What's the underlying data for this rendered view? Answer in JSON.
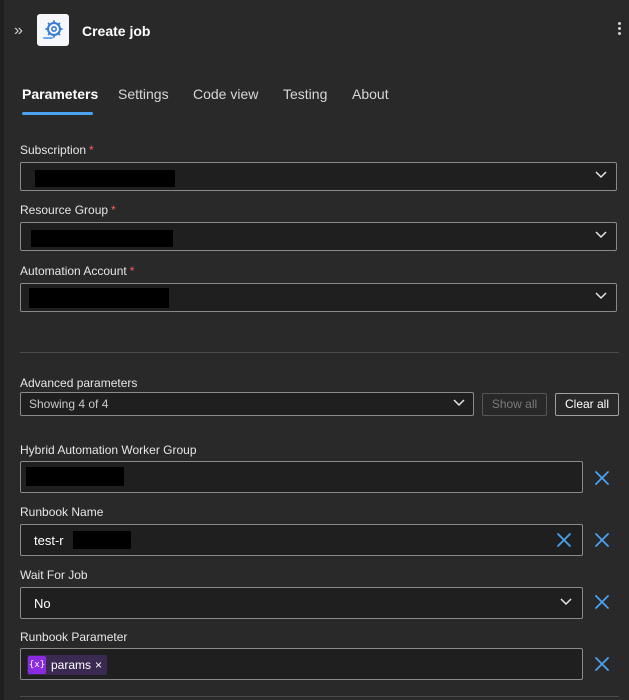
{
  "header": {
    "title": "Create job",
    "collapse_glyph": "»",
    "app_icon": "gear-cloud-icon",
    "more_icon": "more-vertical-icon"
  },
  "tabs": [
    {
      "label": "Parameters",
      "active": true
    },
    {
      "label": "Settings",
      "active": false
    },
    {
      "label": "Code view",
      "active": false
    },
    {
      "label": "Testing",
      "active": false
    },
    {
      "label": "About",
      "active": false
    }
  ],
  "required_fields": {
    "subscription_label": "Subscription",
    "resource_group_label": "Resource Group",
    "automation_account_label": "Automation Account",
    "required_mark": "*"
  },
  "advanced": {
    "label": "Advanced parameters",
    "selected": "Showing 4 of 4",
    "show_all_label": "Show all",
    "clear_all_label": "Clear all"
  },
  "optional_fields": {
    "hybrid_worker_label": "Hybrid Automation Worker Group",
    "runbook_name_label": "Runbook Name",
    "runbook_name_value": "test-r",
    "wait_for_job_label": "Wait For Job",
    "wait_for_job_value": "No",
    "runbook_parameter_label": "Runbook Parameter",
    "token_icon_text": "{x}",
    "token_label": "params",
    "token_remove": "×"
  },
  "colors": {
    "accent": "#4aa2f1",
    "required": "#ff5b5b",
    "token_icon": "#8a2be2",
    "background": "#292929"
  }
}
